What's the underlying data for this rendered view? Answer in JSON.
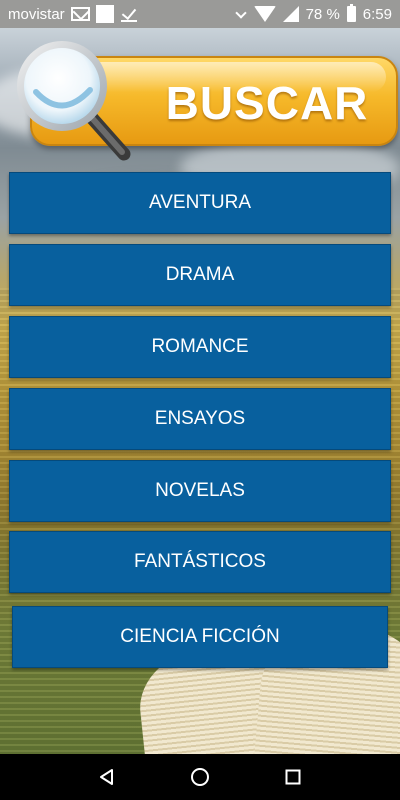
{
  "status_bar": {
    "carrier": "movistar",
    "battery": "78 %",
    "time": "6:59",
    "icons": [
      "mail-icon",
      "square-icon",
      "download-check-icon",
      "vibrate-icon",
      "wifi-icon",
      "signal-icon",
      "battery-icon"
    ]
  },
  "search": {
    "label": "BUSCAR",
    "icon": "magnifier-icon"
  },
  "categories": [
    "AVENTURA",
    "DRAMA",
    "ROMANCE",
    "ENSAYOS",
    "NOVELAS",
    "FANTÁSTICOS",
    "CIENCIA FICCIÓN"
  ],
  "nav_bar": {
    "icons": [
      "back-icon",
      "home-icon",
      "recents-icon"
    ]
  },
  "colors": {
    "button_blue": "#08609e",
    "search_gold": "#f6b92a",
    "status_gray": "#9a9a98",
    "nav_black": "#000000"
  }
}
